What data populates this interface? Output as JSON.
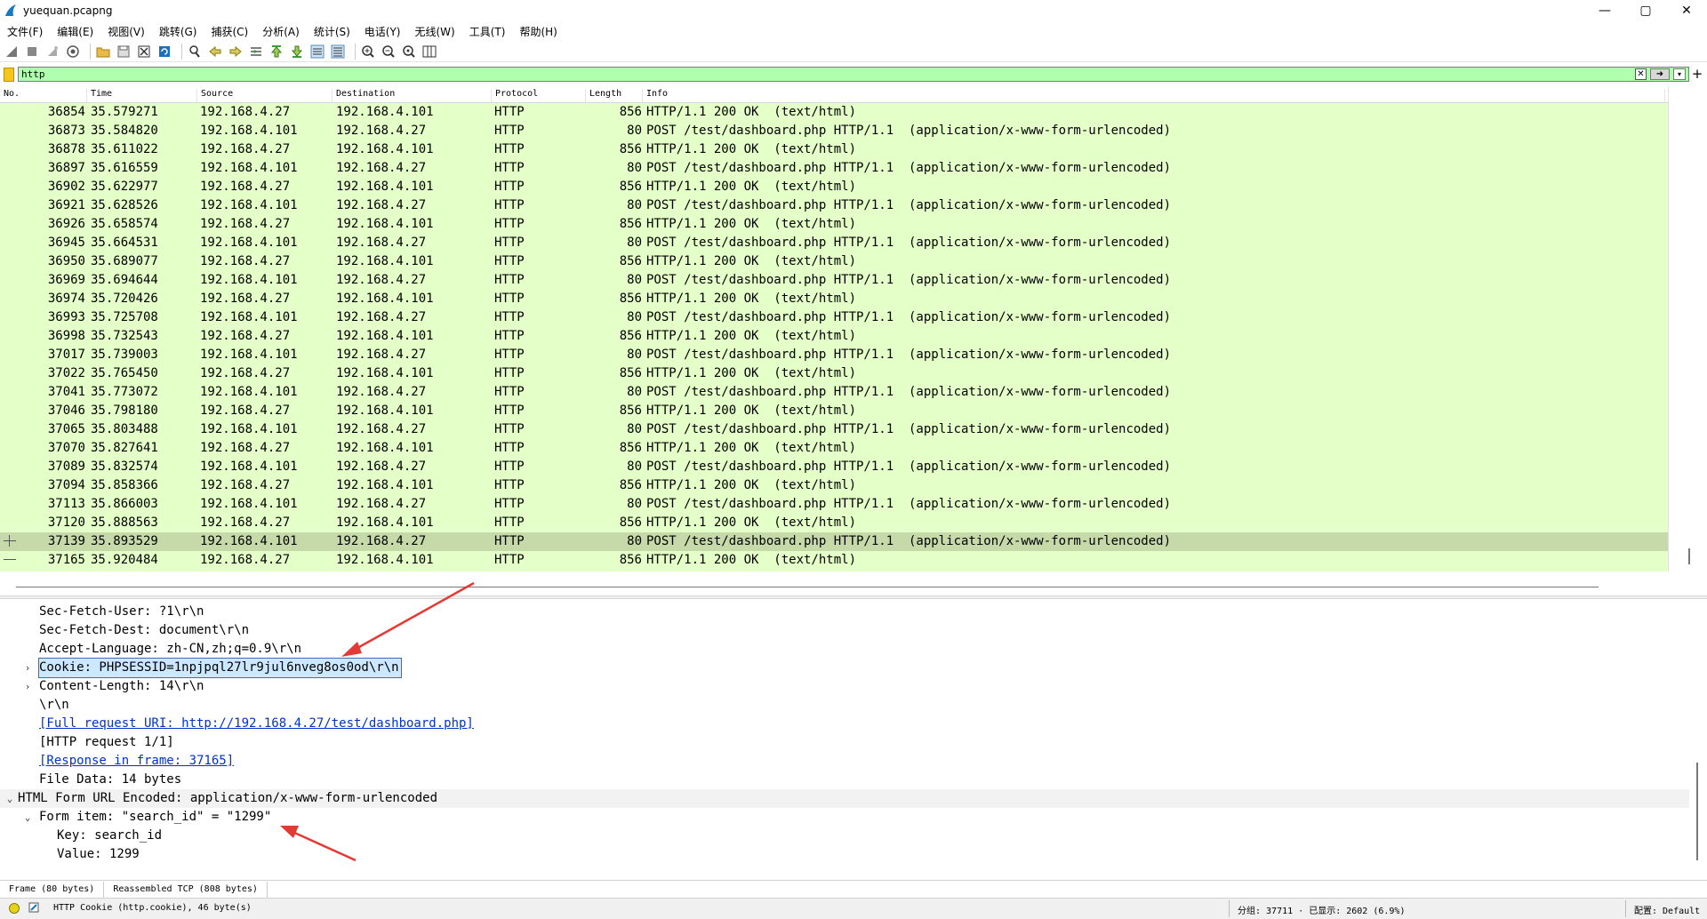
{
  "window": {
    "title": "yuequan.pcapng",
    "controls": {
      "minimize": "—",
      "maximize": "▢",
      "close": "✕"
    }
  },
  "menu": [
    "文件(F)",
    "编辑(E)",
    "视图(V)",
    "跳转(G)",
    "捕获(C)",
    "分析(A)",
    "统计(S)",
    "电话(Y)",
    "无线(W)",
    "工具(T)",
    "帮助(H)"
  ],
  "filter": {
    "value": "http",
    "clear_label": "✕",
    "apply_label": "➜",
    "dropdown_label": "▾",
    "add_label": "+"
  },
  "columns": {
    "no": "No.",
    "time": "Time",
    "source": "Source",
    "destination": "Destination",
    "protocol": "Protocol",
    "length": "Length",
    "info": "Info"
  },
  "packets": [
    {
      "no": "36854",
      "time": "35.579271",
      "src": "192.168.4.27",
      "dst": "192.168.4.101",
      "proto": "HTTP",
      "len": "856",
      "info": "HTTP/1.1 200 OK  (text/html)"
    },
    {
      "no": "36873",
      "time": "35.584820",
      "src": "192.168.4.101",
      "dst": "192.168.4.27",
      "proto": "HTTP",
      "len": "80",
      "info": "POST /test/dashboard.php HTTP/1.1  (application/x-www-form-urlencoded)"
    },
    {
      "no": "36878",
      "time": "35.611022",
      "src": "192.168.4.27",
      "dst": "192.168.4.101",
      "proto": "HTTP",
      "len": "856",
      "info": "HTTP/1.1 200 OK  (text/html)"
    },
    {
      "no": "36897",
      "time": "35.616559",
      "src": "192.168.4.101",
      "dst": "192.168.4.27",
      "proto": "HTTP",
      "len": "80",
      "info": "POST /test/dashboard.php HTTP/1.1  (application/x-www-form-urlencoded)"
    },
    {
      "no": "36902",
      "time": "35.622977",
      "src": "192.168.4.27",
      "dst": "192.168.4.101",
      "proto": "HTTP",
      "len": "856",
      "info": "HTTP/1.1 200 OK  (text/html)"
    },
    {
      "no": "36921",
      "time": "35.628526",
      "src": "192.168.4.101",
      "dst": "192.168.4.27",
      "proto": "HTTP",
      "len": "80",
      "info": "POST /test/dashboard.php HTTP/1.1  (application/x-www-form-urlencoded)"
    },
    {
      "no": "36926",
      "time": "35.658574",
      "src": "192.168.4.27",
      "dst": "192.168.4.101",
      "proto": "HTTP",
      "len": "856",
      "info": "HTTP/1.1 200 OK  (text/html)"
    },
    {
      "no": "36945",
      "time": "35.664531",
      "src": "192.168.4.101",
      "dst": "192.168.4.27",
      "proto": "HTTP",
      "len": "80",
      "info": "POST /test/dashboard.php HTTP/1.1  (application/x-www-form-urlencoded)"
    },
    {
      "no": "36950",
      "time": "35.689077",
      "src": "192.168.4.27",
      "dst": "192.168.4.101",
      "proto": "HTTP",
      "len": "856",
      "info": "HTTP/1.1 200 OK  (text/html)"
    },
    {
      "no": "36969",
      "time": "35.694644",
      "src": "192.168.4.101",
      "dst": "192.168.4.27",
      "proto": "HTTP",
      "len": "80",
      "info": "POST /test/dashboard.php HTTP/1.1  (application/x-www-form-urlencoded)"
    },
    {
      "no": "36974",
      "time": "35.720426",
      "src": "192.168.4.27",
      "dst": "192.168.4.101",
      "proto": "HTTP",
      "len": "856",
      "info": "HTTP/1.1 200 OK  (text/html)"
    },
    {
      "no": "36993",
      "time": "35.725708",
      "src": "192.168.4.101",
      "dst": "192.168.4.27",
      "proto": "HTTP",
      "len": "80",
      "info": "POST /test/dashboard.php HTTP/1.1  (application/x-www-form-urlencoded)"
    },
    {
      "no": "36998",
      "time": "35.732543",
      "src": "192.168.4.27",
      "dst": "192.168.4.101",
      "proto": "HTTP",
      "len": "856",
      "info": "HTTP/1.1 200 OK  (text/html)"
    },
    {
      "no": "37017",
      "time": "35.739003",
      "src": "192.168.4.101",
      "dst": "192.168.4.27",
      "proto": "HTTP",
      "len": "80",
      "info": "POST /test/dashboard.php HTTP/1.1  (application/x-www-form-urlencoded)"
    },
    {
      "no": "37022",
      "time": "35.765450",
      "src": "192.168.4.27",
      "dst": "192.168.4.101",
      "proto": "HTTP",
      "len": "856",
      "info": "HTTP/1.1 200 OK  (text/html)"
    },
    {
      "no": "37041",
      "time": "35.773072",
      "src": "192.168.4.101",
      "dst": "192.168.4.27",
      "proto": "HTTP",
      "len": "80",
      "info": "POST /test/dashboard.php HTTP/1.1  (application/x-www-form-urlencoded)"
    },
    {
      "no": "37046",
      "time": "35.798180",
      "src": "192.168.4.27",
      "dst": "192.168.4.101",
      "proto": "HTTP",
      "len": "856",
      "info": "HTTP/1.1 200 OK  (text/html)"
    },
    {
      "no": "37065",
      "time": "35.803488",
      "src": "192.168.4.101",
      "dst": "192.168.4.27",
      "proto": "HTTP",
      "len": "80",
      "info": "POST /test/dashboard.php HTTP/1.1  (application/x-www-form-urlencoded)"
    },
    {
      "no": "37070",
      "time": "35.827641",
      "src": "192.168.4.27",
      "dst": "192.168.4.101",
      "proto": "HTTP",
      "len": "856",
      "info": "HTTP/1.1 200 OK  (text/html)"
    },
    {
      "no": "37089",
      "time": "35.832574",
      "src": "192.168.4.101",
      "dst": "192.168.4.27",
      "proto": "HTTP",
      "len": "80",
      "info": "POST /test/dashboard.php HTTP/1.1  (application/x-www-form-urlencoded)"
    },
    {
      "no": "37094",
      "time": "35.858366",
      "src": "192.168.4.27",
      "dst": "192.168.4.101",
      "proto": "HTTP",
      "len": "856",
      "info": "HTTP/1.1 200 OK  (text/html)"
    },
    {
      "no": "37113",
      "time": "35.866003",
      "src": "192.168.4.101",
      "dst": "192.168.4.27",
      "proto": "HTTP",
      "len": "80",
      "info": "POST /test/dashboard.php HTTP/1.1  (application/x-www-form-urlencoded)"
    },
    {
      "no": "37120",
      "time": "35.888563",
      "src": "192.168.4.27",
      "dst": "192.168.4.101",
      "proto": "HTTP",
      "len": "856",
      "info": "HTTP/1.1 200 OK  (text/html)"
    },
    {
      "no": "37139",
      "time": "35.893529",
      "src": "192.168.4.101",
      "dst": "192.168.4.27",
      "proto": "HTTP",
      "len": "80",
      "info": "POST /test/dashboard.php HTTP/1.1  (application/x-www-form-urlencoded)",
      "selected": true
    },
    {
      "no": "37165",
      "time": "35.920484",
      "src": "192.168.4.27",
      "dst": "192.168.4.101",
      "proto": "HTTP",
      "len": "856",
      "info": "HTTP/1.1 200 OK  (text/html)"
    }
  ],
  "details": [
    {
      "text": "Sec-Fetch-User: ?1\\r\\n",
      "indent": 1,
      "arrow": ""
    },
    {
      "text": "Sec-Fetch-Dest: document\\r\\n",
      "indent": 1,
      "arrow": ""
    },
    {
      "text": "Accept-Language: zh-CN,zh;q=0.9\\r\\n",
      "indent": 1,
      "arrow": ""
    },
    {
      "text": "Cookie: PHPSESSID=1npjpql27lr9jul6nveg8os0od\\r\\n",
      "indent": 1,
      "arrow": "›",
      "selected": true
    },
    {
      "text": "Content-Length: 14\\r\\n",
      "indent": 1,
      "arrow": "›"
    },
    {
      "text": "\\r\\n",
      "indent": 1,
      "arrow": ""
    },
    {
      "text": "[Full request URI: http://192.168.4.27/test/dashboard.php]",
      "indent": 1,
      "arrow": "",
      "link": true
    },
    {
      "text": "[HTTP request 1/1]",
      "indent": 1,
      "arrow": ""
    },
    {
      "text": "[Response in frame: 37165]",
      "indent": 1,
      "arrow": "",
      "link": true
    },
    {
      "text": "File Data: 14 bytes",
      "indent": 1,
      "arrow": ""
    },
    {
      "text": "HTML Form URL Encoded: application/x-www-form-urlencoded",
      "indent": 0,
      "arrow": "⌄",
      "section": true
    },
    {
      "text": "Form item: \"search_id\" = \"1299\"",
      "indent": 1,
      "arrow": "⌄"
    },
    {
      "text": "Key: search_id",
      "indent": 2,
      "arrow": ""
    },
    {
      "text": "Value: 1299",
      "indent": 2,
      "arrow": ""
    }
  ],
  "byte_tabs": [
    "Frame (80 bytes)",
    "Reassembled TCP (808 bytes)"
  ],
  "status": {
    "field": "HTTP Cookie (http.cookie), 46 byte(s)",
    "stats": "分组: 37711 · 已显示: 2602 (6.9%)",
    "profile": "配置: Default"
  },
  "colors": {
    "row_bg": "#e4ffc7",
    "row_selected": "#c6daa9",
    "filter_bg": "#afffaf",
    "annotation": "#e53935"
  }
}
